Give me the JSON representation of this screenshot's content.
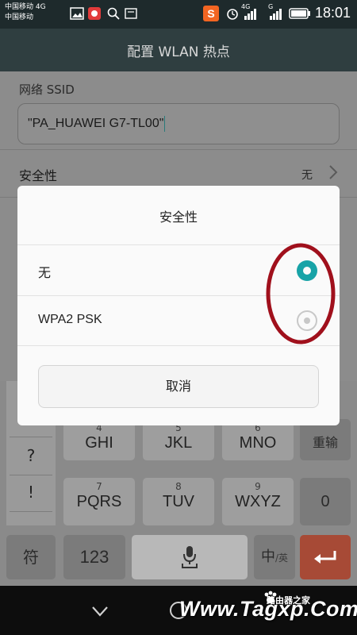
{
  "status_bar": {
    "carrier_line1": "中国移动 4G",
    "carrier_line2": "中国移动",
    "net_4g": "4G",
    "net_g": "G",
    "time": "18:01"
  },
  "header": {
    "title": "配置 WLAN 热点"
  },
  "form": {
    "ssid_label": "网络 SSID",
    "ssid_value": "\"PA_HUAWEI G7-TL00\"",
    "security_label": "安全性",
    "security_value": "无"
  },
  "dialog": {
    "title": "安全性",
    "options": [
      {
        "label": "无",
        "selected": true
      },
      {
        "label": "WPA2 PSK",
        "selected": false
      }
    ],
    "cancel_label": "取消"
  },
  "keyboard": {
    "side_keys": [
      "?",
      "!"
    ],
    "row3": [
      {
        "num": "4",
        "letters": "GHI"
      },
      {
        "num": "5",
        "letters": "JKL"
      },
      {
        "num": "6",
        "letters": "MNO"
      }
    ],
    "row3_action": "重输",
    "row4": [
      {
        "num": "7",
        "letters": "PQRS"
      },
      {
        "num": "8",
        "letters": "TUV"
      },
      {
        "num": "9",
        "letters": "WXYZ"
      }
    ],
    "row4_action": "0",
    "bottom": {
      "symbol": "符",
      "numbers": "123",
      "lang_main": "中",
      "lang_sub": "/英"
    }
  },
  "watermark": {
    "text": "Www.Tagxp.Com",
    "small": "路由器之家"
  },
  "colors": {
    "accent": "#18a3a7",
    "annotation": "#a0101c",
    "enter_key": "#a74a36"
  }
}
